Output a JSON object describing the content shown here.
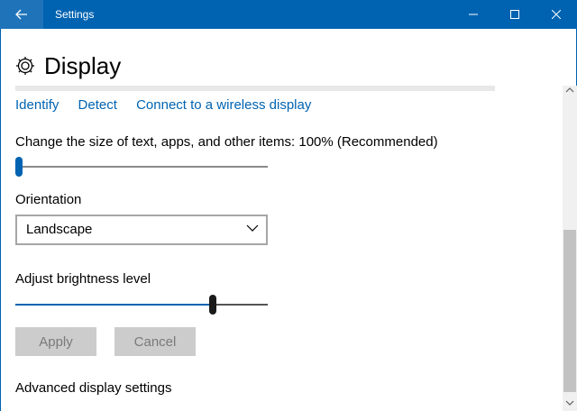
{
  "window": {
    "title": "Settings"
  },
  "header": {
    "title": "Display",
    "icon": "gear-icon"
  },
  "links": {
    "identify": "Identify",
    "detect": "Detect",
    "wireless": "Connect to a wireless display"
  },
  "scale": {
    "label": "Change the size of text, apps, and other items: 100% (Recommended)",
    "position_fraction": 0.0
  },
  "orientation": {
    "label": "Orientation",
    "selected": "Landscape"
  },
  "brightness": {
    "label": "Adjust brightness level",
    "level_fraction": 0.79
  },
  "buttons": {
    "apply": "Apply",
    "cancel": "Cancel"
  },
  "advanced": {
    "label": "Advanced display settings"
  },
  "colors": {
    "accent": "#0063b1",
    "thumb_dark": "#1a1a1a",
    "button_disabled": "#cccccc"
  }
}
